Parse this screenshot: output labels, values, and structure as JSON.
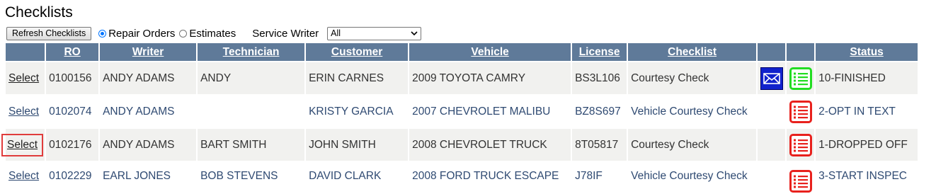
{
  "page": {
    "title": "Checklists"
  },
  "toolbar": {
    "refresh_label": "Refresh Checklists",
    "radio_repair_label": "Repair Orders",
    "radio_estimates_label": "Estimates",
    "selected_mode": "Repair Orders",
    "service_writer_label": "Service Writer",
    "service_writer_value": "All"
  },
  "table": {
    "headers": {
      "select": "",
      "ro": "RO",
      "writer": "Writer",
      "technician": "Technician",
      "customer": "Customer",
      "vehicle": "Vehicle",
      "license": "License",
      "checklist": "Checklist",
      "email": "",
      "list": "",
      "status": "Status"
    },
    "rows": [
      {
        "select": "Select",
        "ro": "0100156",
        "writer": "ANDY ADAMS",
        "technician": "ANDY",
        "customer": "ERIN CARNES",
        "vehicle": "2009 TOYOTA CAMRY",
        "license": "BS3L106",
        "checklist": "Courtesy Check",
        "email_icon": "envelope-icon",
        "list_icon": "checklist-icon",
        "list_icon_color": "#22dd22",
        "status": "10-FINISHED"
      },
      {
        "select": "Select",
        "ro": "0102074",
        "writer": "ANDY ADAMS",
        "technician": "",
        "customer": "KRISTY GARCIA",
        "vehicle": "2007 CHEVROLET MALIBU",
        "license": "BZ8S697",
        "checklist": "Vehicle Courtesy Check",
        "email_icon": "",
        "list_icon": "checklist-icon",
        "list_icon_color": "#e8211d",
        "status": "2-OPT IN TEXT"
      },
      {
        "select": "Select",
        "ro": "0102176",
        "writer": "ANDY ADAMS",
        "technician": "BART SMITH",
        "customer": "JOHN SMITH",
        "vehicle": "2008 CHEVROLET TRUCK",
        "license": "8T05817",
        "checklist": "Courtesy Check",
        "email_icon": "",
        "list_icon": "checklist-icon",
        "list_icon_color": "#e8211d",
        "status": "1-DROPPED OFF"
      },
      {
        "select": "Select",
        "ro": "0102229",
        "writer": "EARL JONES",
        "technician": "BOB STEVENS",
        "customer": "DAVID CLARK",
        "vehicle": "2008 FORD TRUCK ESCAPE",
        "license": "J78IF",
        "checklist": "Vehicle Courtesy Check",
        "email_icon": "",
        "list_icon": "checklist-icon",
        "list_icon_color": "#e8211d",
        "status": "3-START INSPEC"
      }
    ]
  },
  "colors": {
    "header_bg": "#5f7a99",
    "highlight": "#e03c3c",
    "email_icon_bg": "#1122cc"
  }
}
